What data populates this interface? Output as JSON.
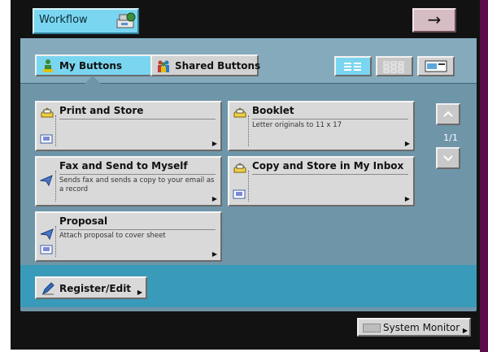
{
  "header": {
    "workflow_label": "Workflow",
    "arrow_label": "→"
  },
  "tabs": {
    "my_buttons": "My Buttons",
    "shared_buttons": "Shared Buttons"
  },
  "buttons": [
    {
      "title": "Print and Store",
      "desc": ""
    },
    {
      "title": "Booklet",
      "desc": "Letter originals to 11 x 17"
    },
    {
      "title": "Fax and Send to Myself",
      "desc": "Sends fax and sends a copy to your email as a record"
    },
    {
      "title": "Copy and Store in My Inbox",
      "desc": ""
    },
    {
      "title": "Proposal",
      "desc": "Attach proposal to cover sheet"
    }
  ],
  "pager": {
    "count": "1/1"
  },
  "footer": {
    "register_label": "Register/Edit",
    "system_monitor_label": "System Monitor"
  },
  "colors": {
    "accent": "#7ad6f0",
    "panel": "#6f95a9",
    "footer_bar": "#3a9ab9"
  }
}
